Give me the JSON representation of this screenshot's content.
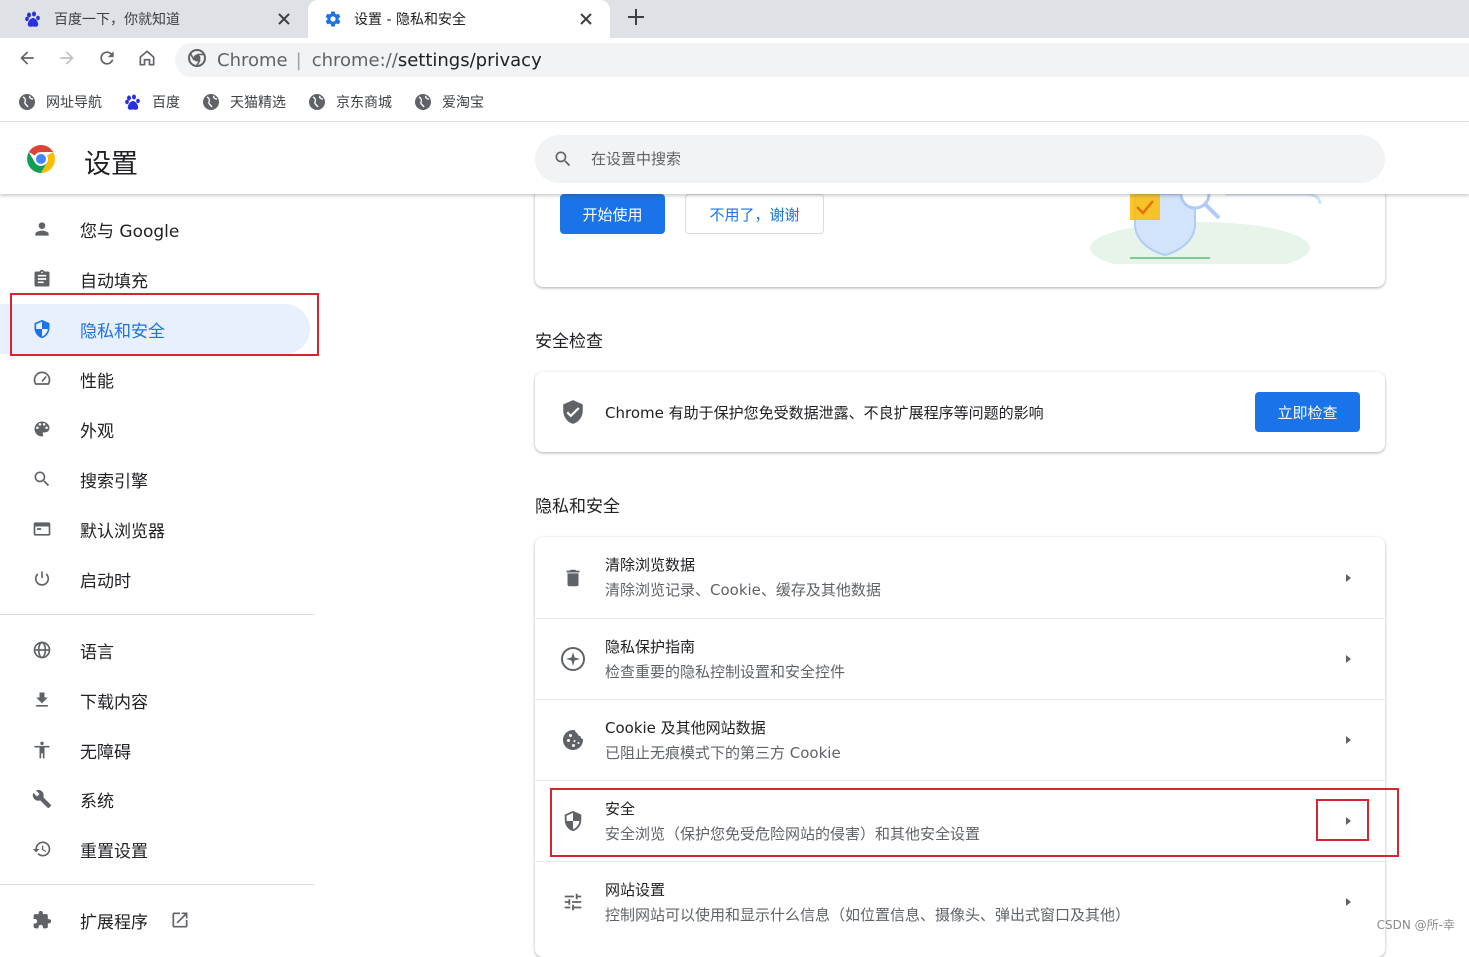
{
  "browser": {
    "tabs": [
      {
        "title": "百度一下，你就知道",
        "icon": "baidu-paw-icon",
        "active": false
      },
      {
        "title": "设置 - 隐私和安全",
        "icon": "gear-icon",
        "active": true
      }
    ],
    "new_tab_icon": "plus-icon",
    "omnibox": {
      "site_label": "Chrome",
      "separator": "|",
      "url_scheme": "chrome://",
      "url_path": "settings/privacy"
    },
    "bookmarks": [
      {
        "label": "网址导航",
        "icon": "globe-icon"
      },
      {
        "label": "百度",
        "icon": "baidu-paw-icon"
      },
      {
        "label": "天猫精选",
        "icon": "globe-icon"
      },
      {
        "label": "京东商城",
        "icon": "globe-icon"
      },
      {
        "label": "爱淘宝",
        "icon": "globe-icon"
      }
    ]
  },
  "settings": {
    "title": "设置",
    "search_placeholder": "在设置中搜索"
  },
  "sidebar": {
    "items": [
      {
        "label": "您与 Google",
        "icon": "person-icon"
      },
      {
        "label": "自动填充",
        "icon": "clipboard-icon"
      },
      {
        "label": "隐私和安全",
        "icon": "shield-icon",
        "active": true
      },
      {
        "label": "性能",
        "icon": "speedometer-icon"
      },
      {
        "label": "外观",
        "icon": "palette-icon"
      },
      {
        "label": "搜索引擎",
        "icon": "search-icon"
      },
      {
        "label": "默认浏览器",
        "icon": "browser-window-icon"
      },
      {
        "label": "启动时",
        "icon": "power-icon"
      },
      {
        "label": "语言",
        "icon": "globe-icon"
      },
      {
        "label": "下载内容",
        "icon": "download-icon"
      },
      {
        "label": "无障碍",
        "icon": "accessibility-icon"
      },
      {
        "label": "系统",
        "icon": "wrench-icon"
      },
      {
        "label": "重置设置",
        "icon": "history-icon"
      },
      {
        "label": "扩展程序",
        "icon": "puzzle-icon"
      }
    ]
  },
  "promo": {
    "start_label": "开始使用",
    "decline_label": "不用了，谢谢"
  },
  "safety_check": {
    "heading": "安全检查",
    "description": "Chrome 有助于保护您免受数据泄露、不良扩展程序等问题的影响",
    "button_label": "立即检查"
  },
  "privacy": {
    "heading": "隐私和安全",
    "rows": [
      {
        "title": "清除浏览数据",
        "subtitle": "清除浏览记录、Cookie、缓存及其他数据",
        "icon": "trash-icon"
      },
      {
        "title": "隐私保护指南",
        "subtitle": "检查重要的隐私控制设置和安全控件",
        "icon": "compass-icon"
      },
      {
        "title": "Cookie 及其他网站数据",
        "subtitle": "已阻止无痕模式下的第三方 Cookie",
        "icon": "cookie-icon"
      },
      {
        "title": "安全",
        "subtitle": "安全浏览（保护您免受危险网站的侵害）和其他安全设置",
        "icon": "shield-icon"
      },
      {
        "title": "网站设置",
        "subtitle": "控制网站可以使用和显示什么信息（如位置信息、摄像头、弹出式窗口及其他）",
        "icon": "tune-icon"
      }
    ]
  },
  "watermark": "CSDN @所-幸",
  "colors": {
    "accent": "#1a73e8",
    "active_bg": "#e8f0fe",
    "highlight_frame": "#d9232d"
  }
}
